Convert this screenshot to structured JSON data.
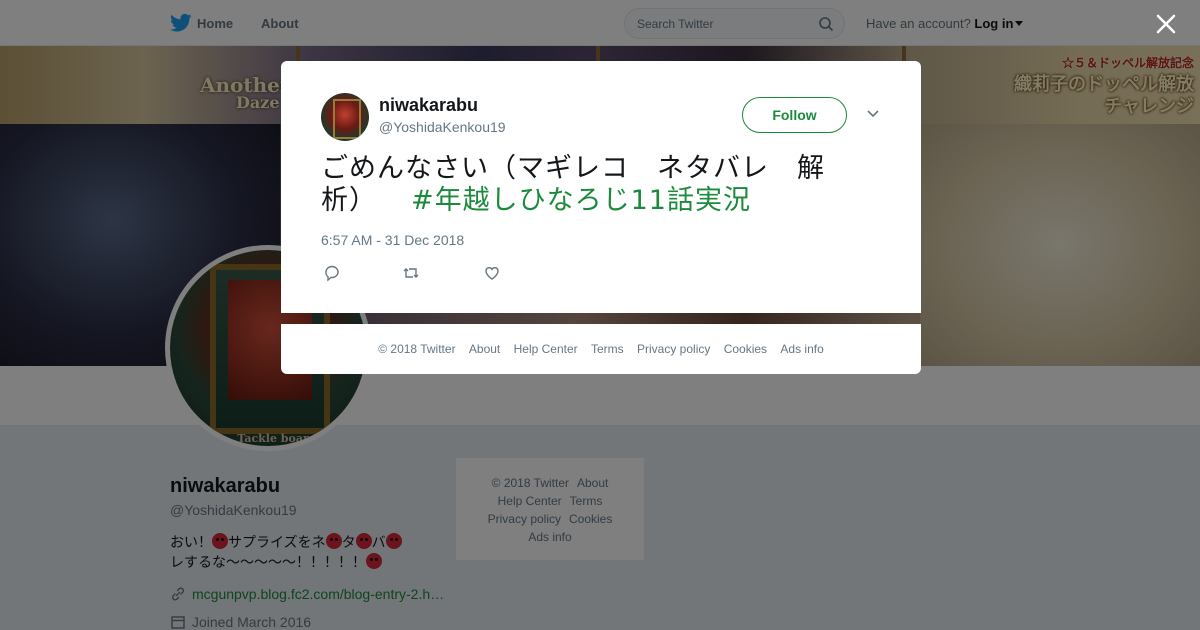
{
  "nav": {
    "home": "Home",
    "about": "About",
    "search_placeholder": "Search Twitter",
    "have_account": "Have an account?",
    "login": "Log in"
  },
  "banner": {
    "text_left": "Another",
    "text_left2": "Daze",
    "text_right_line1": "☆５＆ドッペル解放記念",
    "text_right_line2": "織莉子のドッペル解放",
    "text_right_line3": "チャレンジ"
  },
  "profile": {
    "card_label": "Tackle boar",
    "name": "niwakarabu",
    "handle": "@YoshidaKenkou19",
    "bio_line1_a": "おい！",
    "bio_line1_b": "サプライズをネ",
    "bio_line1_c": "タ",
    "bio_line1_d": "バ",
    "bio_line2": "レするな～～～～～！！！！！",
    "link": "mcgunpvp.blog.fc2.com/blog-entry-2.h…",
    "joined": "Joined March 2016"
  },
  "side_footer": {
    "copyright": "© 2018 Twitter",
    "about": "About",
    "help": "Help Center",
    "terms": "Terms",
    "privacy": "Privacy policy",
    "cookies": "Cookies",
    "ads": "Ads info"
  },
  "tweet": {
    "name": "niwakarabu",
    "handle": "@YoshidaKenkou19",
    "follow_label": "Follow",
    "text_line1": "ごめんなさい（マギレコ　ネタバレ　解",
    "text_line2": "析）",
    "hashtag": "#年越しひなろじ11話実況",
    "timestamp": "6:57 AM - 31 Dec 2018"
  },
  "modal_footer": {
    "copyright": "© 2018 Twitter",
    "about": "About",
    "help": "Help Center",
    "terms": "Terms",
    "privacy": "Privacy policy",
    "cookies": "Cookies",
    "ads": "Ads info"
  },
  "colors": {
    "link_green": "#1c8a3c",
    "twitter_blue": "#1da1f2",
    "overlay": "rgba(0,0,0,0.5)"
  }
}
